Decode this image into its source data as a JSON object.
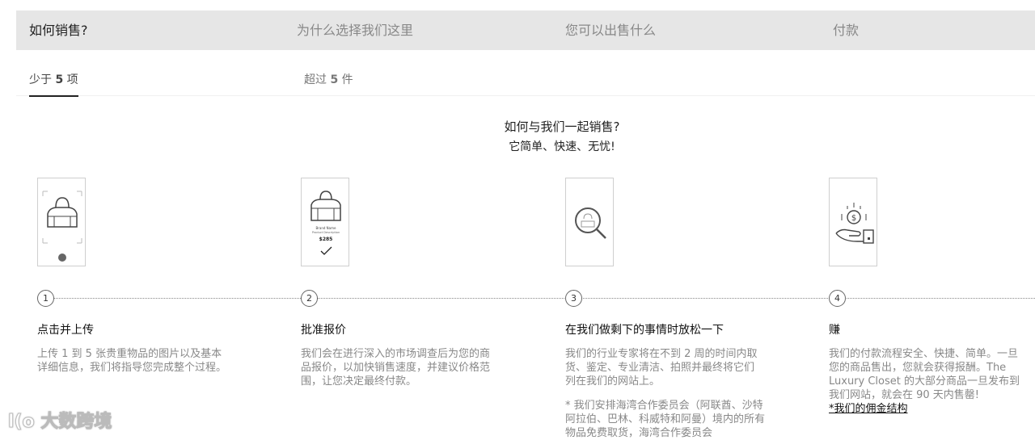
{
  "tabs": [
    {
      "label": "如何销售?"
    },
    {
      "label": "为什么选择我们这里"
    },
    {
      "label": "您可以出售什么"
    },
    {
      "label": "付款"
    }
  ],
  "subtabs": [
    {
      "prefix": "少于 ",
      "number": "5",
      "suffix": " 项"
    },
    {
      "prefix": "超过 ",
      "number": "5",
      "suffix": " 件"
    }
  ],
  "intro": {
    "title": "如何与我们一起销售?",
    "subtitle": "它简单、快速、无忧!"
  },
  "card2": {
    "brand": "Brand Name",
    "desc": "Product Description",
    "price": "$285"
  },
  "steps": [
    {
      "number": "1",
      "title": "点击并上传",
      "desc": "上传 1 到 5 张贵重物品的图片以及基本详细信息，我们将指导您完成整个过程。"
    },
    {
      "number": "2",
      "title": "批准报价",
      "desc": "我们会在进行深入的市场调查后为您的商品报价，以加快销售速度，并建议价格范围，让您决定最终付款。"
    },
    {
      "number": "3",
      "title": "在我们做剩下的事情时放松一下",
      "desc": "我们的行业专家将在不到 2 周的时间内取货、鉴定、专业清洁、拍照并最终将它们列在我们的网站上。",
      "note": "* 我们安排海湾合作委员会（阿联酋、沙特阿拉伯、巴林、科威特和阿曼）境内的所有物品免费取货，海湾合作委员会"
    },
    {
      "number": "4",
      "title": "赚",
      "desc": "我们的付款流程安全、快捷、简单。一旦您的商品售出，您就会获得报酬。The Luxury Closet 的大部分商品一旦发布到我们网站，就会在 90 天内售罄!",
      "link": "*我们的佣金结构"
    }
  ],
  "watermark": "大数跨境",
  "watermark_logo": "l(o"
}
